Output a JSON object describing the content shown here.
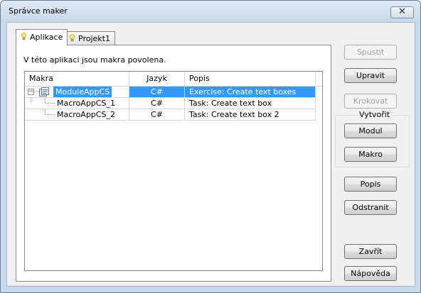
{
  "window": {
    "title": "Správce maker",
    "close_glyph": "✕"
  },
  "tabs": [
    {
      "label": "Aplikace",
      "icon": "lightbulb-icon",
      "active": true
    },
    {
      "label": "Projekt1",
      "icon": "lightbulb-icon",
      "active": false
    }
  ],
  "panel": {
    "info": "V této aplikaci jsou makra povolena."
  },
  "list": {
    "columns": [
      "Makra",
      "Jazyk",
      "Popis"
    ],
    "rows": [
      {
        "name": "ModuleAppCS",
        "language": "C#",
        "description": "Exercise: Create text boxes",
        "selected": true,
        "expanded": true,
        "icon": "module-icon"
      },
      {
        "name": "MacroAppCS_1",
        "language": "C#",
        "description": "Task: Create text box",
        "selected": false
      },
      {
        "name": "MacroAppCS_2",
        "language": "C#",
        "description": "Task: Create text box 2",
        "selected": false
      }
    ]
  },
  "buttons": {
    "run": "Spustit",
    "edit": "Upravit",
    "step": "Krokovat",
    "create_group": "Vytvořit",
    "module": "Modul",
    "macro": "Makro",
    "description": "Popis",
    "remove": "Odstranit",
    "close": "Zavřít",
    "help": "Nápověda"
  },
  "colors": {
    "selection": "#3399ff",
    "frame": "#c9d9ec"
  }
}
